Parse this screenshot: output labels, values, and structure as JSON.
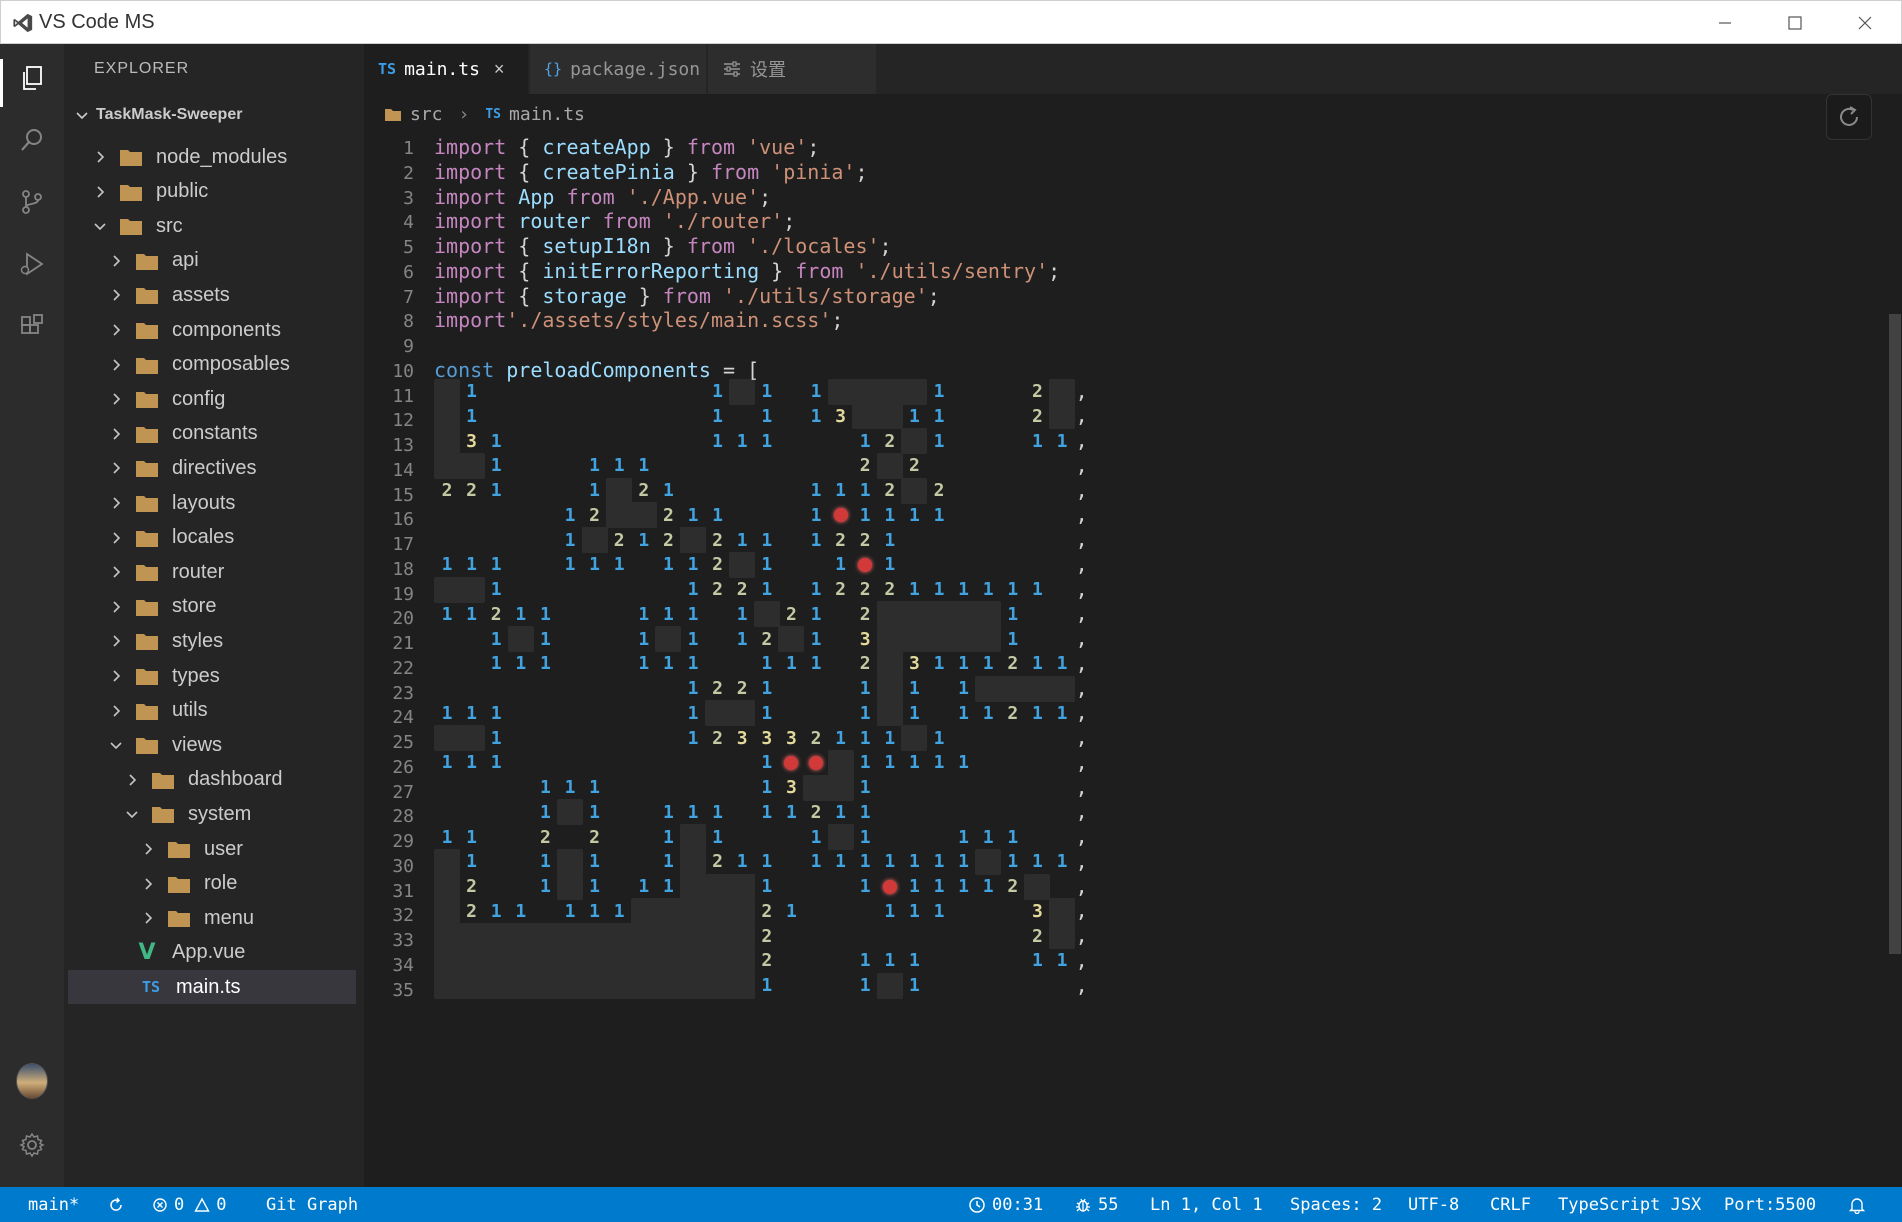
{
  "window": {
    "title": "VS Code MS"
  },
  "explorer": {
    "title": "EXPLORER",
    "project": "TaskMask-Sweeper",
    "tree": [
      {
        "label": "node_modules",
        "type": "folder",
        "depth": 1,
        "state": "collapsed"
      },
      {
        "label": "public",
        "type": "folder",
        "depth": 1,
        "state": "collapsed"
      },
      {
        "label": "src",
        "type": "folder",
        "depth": 1,
        "state": "expanded"
      },
      {
        "label": "api",
        "type": "folder",
        "depth": 2,
        "state": "collapsed"
      },
      {
        "label": "assets",
        "type": "folder",
        "depth": 2,
        "state": "collapsed"
      },
      {
        "label": "components",
        "type": "folder",
        "depth": 2,
        "state": "collapsed"
      },
      {
        "label": "composables",
        "type": "folder",
        "depth": 2,
        "state": "collapsed"
      },
      {
        "label": "config",
        "type": "folder",
        "depth": 2,
        "state": "collapsed"
      },
      {
        "label": "constants",
        "type": "folder",
        "depth": 2,
        "state": "collapsed"
      },
      {
        "label": "directives",
        "type": "folder",
        "depth": 2,
        "state": "collapsed"
      },
      {
        "label": "layouts",
        "type": "folder",
        "depth": 2,
        "state": "collapsed"
      },
      {
        "label": "locales",
        "type": "folder",
        "depth": 2,
        "state": "collapsed"
      },
      {
        "label": "router",
        "type": "folder",
        "depth": 2,
        "state": "collapsed"
      },
      {
        "label": "store",
        "type": "folder",
        "depth": 2,
        "state": "collapsed"
      },
      {
        "label": "styles",
        "type": "folder",
        "depth": 2,
        "state": "collapsed"
      },
      {
        "label": "types",
        "type": "folder",
        "depth": 2,
        "state": "collapsed"
      },
      {
        "label": "utils",
        "type": "folder",
        "depth": 2,
        "state": "collapsed"
      },
      {
        "label": "views",
        "type": "folder",
        "depth": 2,
        "state": "expanded"
      },
      {
        "label": "dashboard",
        "type": "folder",
        "depth": 3,
        "state": "collapsed"
      },
      {
        "label": "system",
        "type": "folder",
        "depth": 3,
        "state": "expanded"
      },
      {
        "label": "user",
        "type": "folder",
        "depth": 4,
        "state": "collapsed"
      },
      {
        "label": "role",
        "type": "folder",
        "depth": 4,
        "state": "collapsed"
      },
      {
        "label": "menu",
        "type": "folder",
        "depth": 4,
        "state": "collapsed"
      },
      {
        "label": "App.vue",
        "type": "vue",
        "depth": 2
      },
      {
        "label": "main.ts",
        "type": "ts",
        "depth": 2,
        "selected": true
      }
    ]
  },
  "tabs": [
    {
      "label": "main.ts",
      "badge": "TS",
      "active": true,
      "close": "×"
    },
    {
      "label": "package.json",
      "badge": "{}",
      "active": false
    },
    {
      "label": "设置",
      "badge": "settings",
      "active": false
    }
  ],
  "breadcrumb": {
    "folder": "src",
    "file_badge": "TS",
    "file": "main.ts"
  },
  "code": {
    "lines": [
      [
        [
          "kw",
          "import"
        ],
        [
          "pun",
          " { "
        ],
        [
          "id",
          "createApp"
        ],
        [
          "pun",
          " } "
        ],
        [
          "kw",
          "from"
        ],
        [
          "pun",
          " "
        ],
        [
          "str",
          "'vue'"
        ],
        [
          "pun",
          ";"
        ]
      ],
      [
        [
          "kw",
          "import"
        ],
        [
          "pun",
          " { "
        ],
        [
          "id",
          "createPinia"
        ],
        [
          "pun",
          " } "
        ],
        [
          "kw",
          "from"
        ],
        [
          "pun",
          " "
        ],
        [
          "str",
          "'pinia'"
        ],
        [
          "pun",
          ";"
        ]
      ],
      [
        [
          "kw",
          "import"
        ],
        [
          "pun",
          " "
        ],
        [
          "id",
          "App"
        ],
        [
          "pun",
          " "
        ],
        [
          "kw",
          "from"
        ],
        [
          "pun",
          " "
        ],
        [
          "str",
          "'./App.vue'"
        ],
        [
          "pun",
          ";"
        ]
      ],
      [
        [
          "kw",
          "import"
        ],
        [
          "pun",
          " "
        ],
        [
          "id",
          "router"
        ],
        [
          "pun",
          " "
        ],
        [
          "kw",
          "from"
        ],
        [
          "pun",
          " "
        ],
        [
          "str",
          "'./router'"
        ],
        [
          "pun",
          ";"
        ]
      ],
      [
        [
          "kw",
          "import"
        ],
        [
          "pun",
          " { "
        ],
        [
          "id",
          "setupI18n"
        ],
        [
          "pun",
          " } "
        ],
        [
          "kw",
          "from"
        ],
        [
          "pun",
          " "
        ],
        [
          "str",
          "'./locales'"
        ],
        [
          "pun",
          ";"
        ]
      ],
      [
        [
          "kw",
          "import"
        ],
        [
          "pun",
          " { "
        ],
        [
          "id",
          "initErrorReporting"
        ],
        [
          "pun",
          " } "
        ],
        [
          "kw",
          "from"
        ],
        [
          "pun",
          " "
        ],
        [
          "str",
          "'./utils/sentry'"
        ],
        [
          "pun",
          ";"
        ]
      ],
      [
        [
          "kw",
          "import"
        ],
        [
          "pun",
          " { "
        ],
        [
          "id",
          "storage"
        ],
        [
          "pun",
          " } "
        ],
        [
          "kw",
          "from"
        ],
        [
          "pun",
          " "
        ],
        [
          "str",
          "'./utils/storage'"
        ],
        [
          "pun",
          ";"
        ]
      ],
      [
        [
          "kw",
          "import"
        ],
        [
          "str",
          "'./assets/styles/main.scss'"
        ],
        [
          "pun",
          ";"
        ]
      ],
      [],
      [
        [
          "kb",
          "const"
        ],
        [
          "pun",
          " "
        ],
        [
          "id",
          "preloadComponents"
        ],
        [
          "pun",
          " = ["
        ]
      ]
    ],
    "line_count": 35,
    "board_end_chars": [
      ",",
      ",",
      ",",
      ",",
      ",",
      ",",
      ",",
      ",",
      ",",
      ",",
      ",",
      ",",
      ",",
      ",",
      ",",
      ",",
      ",",
      ",",
      ",",
      ",",
      ",",
      ",",
      ",",
      ",",
      ",",
      "]"
    ],
    "board": [
      "#1.........1#1.1####1...2#",
      "#1.........1.1.13##11...2#",
      "#31........111...12#1...11",
      "##1...111........2#2......",
      "221...1#21.....1112#2.....",
      ".....12##211...1*1111.....",
      ".....1#212#211.1221.......",
      "111..111.112#1..1*1.......",
      "##1.......1221.1222111111.",
      "11211...111.1#21.2#####1..",
      "..1#1...1#1.12#1.3#####1..",
      "..111...111..111.2#3111211",
      "..........1221...1#1.1####",
      "111.......1##1...1#1.11211",
      "##1.......123332111#1.....",
      "111..........1**#11111....",
      "....111......13##1........",
      "....1#1..111.11211........",
      "11..2.2..1#1...1#1...111..",
      "#1..1#1..1#211.1111111#111",
      "#2..1#1.11###1...1*11112#.",
      "#211.111#####21...111...3#",
      "#############2..........2#",
      "#############2...111....11",
      "#############1...1#1......"
    ]
  },
  "statusbar": {
    "branch": "main*",
    "errors": "0",
    "warnings": "0",
    "git_graph": "Git Graph",
    "timer": "00:31",
    "bugs": "55",
    "position": "Ln 1, Col 1",
    "spaces": "Spaces: 2",
    "encoding": "UTF-8",
    "eol": "CRLF",
    "language": "TypeScript JSX",
    "port": "Port:5500"
  },
  "colors": {
    "statusbar": "#007acc",
    "sidebar": "#252526",
    "editor": "#1e1e1e",
    "mine": "#d23a3a",
    "number1": "#41a3e0"
  }
}
